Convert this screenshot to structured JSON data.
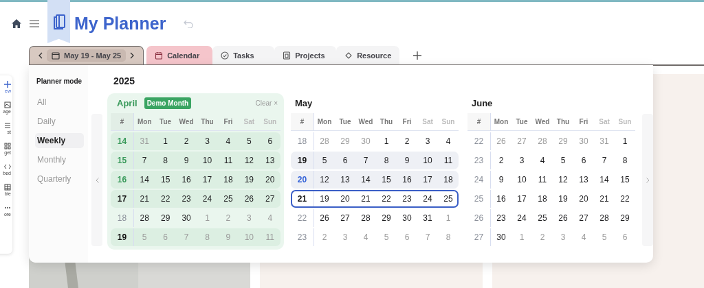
{
  "header": {
    "title": "My Planner"
  },
  "tabs": [
    {
      "kind": "date",
      "label": "May 19 - May 25",
      "selected": true,
      "color": "#d8c9c1"
    },
    {
      "kind": "calendar",
      "label": "Calendar",
      "selected": false,
      "color": "#f5c5cb"
    },
    {
      "kind": "check",
      "label": "Tasks",
      "selected": false
    },
    {
      "kind": "board",
      "label": "Projects",
      "selected": false
    },
    {
      "kind": "diamond",
      "label": "Resource",
      "selected": false
    }
  ],
  "side_tools": [
    {
      "kind": "plus",
      "label": "ew"
    },
    {
      "kind": "page",
      "label": "age"
    },
    {
      "kind": "list",
      "label": "st"
    },
    {
      "kind": "widget",
      "label": "get"
    },
    {
      "kind": "code",
      "label": "bed"
    },
    {
      "kind": "table",
      "label": "ble"
    },
    {
      "kind": "dots",
      "label": "ore"
    }
  ],
  "planner": {
    "mode_title": "Planner mode",
    "modes": [
      {
        "label": "All",
        "selected": false
      },
      {
        "label": "Daily",
        "selected": false
      },
      {
        "label": "Weekly",
        "selected": true
      },
      {
        "label": "Monthly",
        "selected": false
      },
      {
        "label": "Quarterly",
        "selected": false
      }
    ],
    "year": "2025",
    "months": [
      {
        "name": "April",
        "demo": true,
        "badge": "Demo Month",
        "clear": "Clear ×",
        "columns": [
          "#",
          "Mon",
          "Tue",
          "Wed",
          "Thu",
          "Fri",
          "Sat",
          "Sun"
        ],
        "weeks": [
          {
            "number": "14",
            "kind": "accent",
            "shaded": true,
            "selected": false,
            "days": [
              {
                "t": "31",
                "outside": true
              },
              {
                "t": "1",
                "outside": false
              },
              {
                "t": "2",
                "outside": false
              },
              {
                "t": "3",
                "outside": false
              },
              {
                "t": "4",
                "outside": false
              },
              {
                "t": "5",
                "outside": false
              },
              {
                "t": "6",
                "outside": false
              }
            ]
          },
          {
            "number": "15",
            "kind": "accent",
            "shaded": true,
            "selected": false,
            "days": [
              {
                "t": "7",
                "outside": false
              },
              {
                "t": "8",
                "outside": false
              },
              {
                "t": "9",
                "outside": false
              },
              {
                "t": "10",
                "outside": false
              },
              {
                "t": "11",
                "outside": false
              },
              {
                "t": "12",
                "outside": false
              },
              {
                "t": "13",
                "outside": false
              }
            ]
          },
          {
            "number": "16",
            "kind": "accent",
            "shaded": true,
            "selected": false,
            "days": [
              {
                "t": "14",
                "outside": false
              },
              {
                "t": "15",
                "outside": false
              },
              {
                "t": "16",
                "outside": false
              },
              {
                "t": "17",
                "outside": false
              },
              {
                "t": "18",
                "outside": false
              },
              {
                "t": "19",
                "outside": false
              },
              {
                "t": "20",
                "outside": false
              }
            ]
          },
          {
            "number": "17",
            "kind": "strong",
            "shaded": true,
            "selected": false,
            "days": [
              {
                "t": "21",
                "outside": false
              },
              {
                "t": "22",
                "outside": false
              },
              {
                "t": "23",
                "outside": false
              },
              {
                "t": "24",
                "outside": false
              },
              {
                "t": "25",
                "outside": false
              },
              {
                "t": "26",
                "outside": false
              },
              {
                "t": "27",
                "outside": false
              }
            ]
          },
          {
            "number": "18",
            "kind": "muted",
            "shaded": false,
            "selected": false,
            "days": [
              {
                "t": "28",
                "outside": false
              },
              {
                "t": "29",
                "outside": false
              },
              {
                "t": "30",
                "outside": false
              },
              {
                "t": "1",
                "outside": true
              },
              {
                "t": "2",
                "outside": true
              },
              {
                "t": "3",
                "outside": true
              },
              {
                "t": "4",
                "outside": true
              }
            ]
          },
          {
            "number": "19",
            "kind": "strong",
            "shaded": true,
            "selected": false,
            "days": [
              {
                "t": "5",
                "outside": true
              },
              {
                "t": "6",
                "outside": true
              },
              {
                "t": "7",
                "outside": true
              },
              {
                "t": "8",
                "outside": true
              },
              {
                "t": "9",
                "outside": true
              },
              {
                "t": "10",
                "outside": true
              },
              {
                "t": "11",
                "outside": true
              }
            ]
          }
        ]
      },
      {
        "name": "May",
        "demo": false,
        "columns": [
          "#",
          "Mon",
          "Tue",
          "Wed",
          "Thu",
          "Fri",
          "Sat",
          "Sun"
        ],
        "weeks": [
          {
            "number": "18",
            "kind": "muted",
            "shaded": false,
            "selected": false,
            "days": [
              {
                "t": "28",
                "outside": true
              },
              {
                "t": "29",
                "outside": true
              },
              {
                "t": "30",
                "outside": true
              },
              {
                "t": "1",
                "outside": false
              },
              {
                "t": "2",
                "outside": false
              },
              {
                "t": "3",
                "outside": false
              },
              {
                "t": "4",
                "outside": false
              }
            ]
          },
          {
            "number": "19",
            "kind": "strong",
            "shaded": true,
            "selected": false,
            "days": [
              {
                "t": "5",
                "outside": false
              },
              {
                "t": "6",
                "outside": false
              },
              {
                "t": "7",
                "outside": false
              },
              {
                "t": "8",
                "outside": false
              },
              {
                "t": "9",
                "outside": false
              },
              {
                "t": "10",
                "outside": false
              },
              {
                "t": "11",
                "outside": false
              }
            ]
          },
          {
            "number": "20",
            "kind": "accent",
            "shaded": true,
            "selected": false,
            "days": [
              {
                "t": "12",
                "outside": false
              },
              {
                "t": "13",
                "outside": false
              },
              {
                "t": "14",
                "outside": false
              },
              {
                "t": "15",
                "outside": false
              },
              {
                "t": "16",
                "outside": false
              },
              {
                "t": "17",
                "outside": false
              },
              {
                "t": "18",
                "outside": false
              }
            ]
          },
          {
            "number": "21",
            "kind": "strong",
            "shaded": false,
            "selected": true,
            "days": [
              {
                "t": "19",
                "outside": false
              },
              {
                "t": "20",
                "outside": false
              },
              {
                "t": "21",
                "outside": false
              },
              {
                "t": "22",
                "outside": false
              },
              {
                "t": "23",
                "outside": false
              },
              {
                "t": "24",
                "outside": false
              },
              {
                "t": "25",
                "outside": false
              }
            ]
          },
          {
            "number": "22",
            "kind": "muted",
            "shaded": false,
            "selected": false,
            "days": [
              {
                "t": "26",
                "outside": false
              },
              {
                "t": "27",
                "outside": false
              },
              {
                "t": "28",
                "outside": false
              },
              {
                "t": "29",
                "outside": false
              },
              {
                "t": "30",
                "outside": false
              },
              {
                "t": "31",
                "outside": false
              },
              {
                "t": "1",
                "outside": true
              }
            ]
          },
          {
            "number": "23",
            "kind": "muted",
            "shaded": false,
            "selected": false,
            "days": [
              {
                "t": "2",
                "outside": true
              },
              {
                "t": "3",
                "outside": true
              },
              {
                "t": "4",
                "outside": true
              },
              {
                "t": "5",
                "outside": true
              },
              {
                "t": "6",
                "outside": true
              },
              {
                "t": "7",
                "outside": true
              },
              {
                "t": "8",
                "outside": true
              }
            ]
          }
        ]
      },
      {
        "name": "June",
        "demo": false,
        "columns": [
          "#",
          "Mon",
          "Tue",
          "Wed",
          "Thu",
          "Fri",
          "Sat",
          "Sun"
        ],
        "weeks": [
          {
            "number": "22",
            "kind": "muted",
            "shaded": false,
            "selected": false,
            "days": [
              {
                "t": "26",
                "outside": true
              },
              {
                "t": "27",
                "outside": true
              },
              {
                "t": "28",
                "outside": true
              },
              {
                "t": "29",
                "outside": true
              },
              {
                "t": "30",
                "outside": true
              },
              {
                "t": "31",
                "outside": true
              },
              {
                "t": "1",
                "outside": false
              }
            ]
          },
          {
            "number": "23",
            "kind": "muted",
            "shaded": false,
            "selected": false,
            "days": [
              {
                "t": "2",
                "outside": false
              },
              {
                "t": "3",
                "outside": false
              },
              {
                "t": "4",
                "outside": false
              },
              {
                "t": "5",
                "outside": false
              },
              {
                "t": "6",
                "outside": false
              },
              {
                "t": "7",
                "outside": false
              },
              {
                "t": "8",
                "outside": false
              }
            ]
          },
          {
            "number": "24",
            "kind": "muted",
            "shaded": false,
            "selected": false,
            "days": [
              {
                "t": "9",
                "outside": false
              },
              {
                "t": "10",
                "outside": false
              },
              {
                "t": "11",
                "outside": false
              },
              {
                "t": "12",
                "outside": false
              },
              {
                "t": "13",
                "outside": false
              },
              {
                "t": "14",
                "outside": false
              },
              {
                "t": "15",
                "outside": false
              }
            ]
          },
          {
            "number": "25",
            "kind": "muted",
            "shaded": false,
            "selected": false,
            "days": [
              {
                "t": "16",
                "outside": false
              },
              {
                "t": "17",
                "outside": false
              },
              {
                "t": "18",
                "outside": false
              },
              {
                "t": "19",
                "outside": false
              },
              {
                "t": "20",
                "outside": false
              },
              {
                "t": "21",
                "outside": false
              },
              {
                "t": "22",
                "outside": false
              }
            ]
          },
          {
            "number": "26",
            "kind": "muted",
            "shaded": false,
            "selected": false,
            "days": [
              {
                "t": "23",
                "outside": false
              },
              {
                "t": "24",
                "outside": false
              },
              {
                "t": "25",
                "outside": false
              },
              {
                "t": "26",
                "outside": false
              },
              {
                "t": "27",
                "outside": false
              },
              {
                "t": "28",
                "outside": false
              },
              {
                "t": "29",
                "outside": false
              }
            ]
          },
          {
            "number": "27",
            "kind": "muted",
            "shaded": false,
            "selected": false,
            "days": [
              {
                "t": "30",
                "outside": false
              },
              {
                "t": "1",
                "outside": true
              },
              {
                "t": "2",
                "outside": true
              },
              {
                "t": "3",
                "outside": true
              },
              {
                "t": "4",
                "outside": true
              },
              {
                "t": "5",
                "outside": true
              },
              {
                "t": "6",
                "outside": true
              }
            ]
          }
        ]
      }
    ]
  }
}
